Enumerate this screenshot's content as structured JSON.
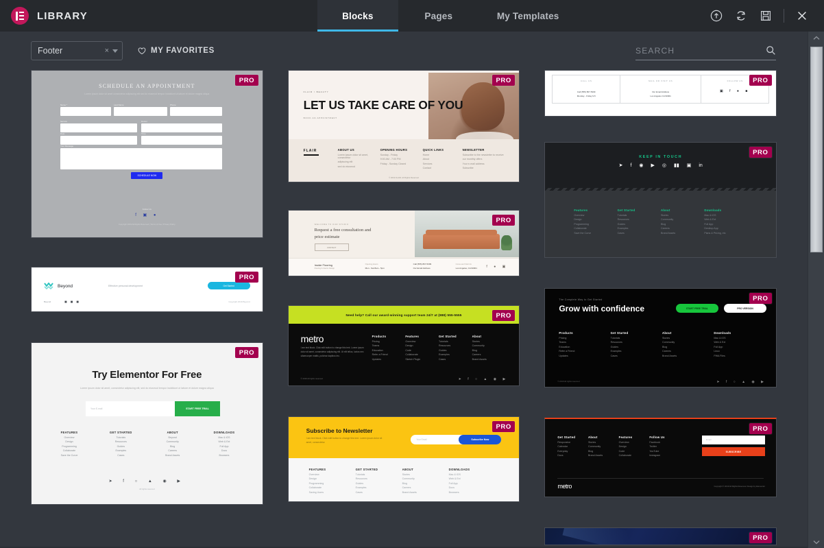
{
  "header": {
    "brand_title": "LIBRARY",
    "logo_icon": "elementor-logo-icon",
    "accent_color": "#c2185b",
    "tabs": [
      {
        "label": "Blocks",
        "active": true
      },
      {
        "label": "Pages",
        "active": false
      },
      {
        "label": "My Templates",
        "active": false
      }
    ],
    "active_tab_underline_color": "#3fb8e8",
    "actions": [
      {
        "name": "import-template-icon",
        "glyph": "↑"
      },
      {
        "name": "sync-library-icon",
        "glyph": "⟳"
      },
      {
        "name": "save-icon",
        "glyph": "Ὃe"
      },
      {
        "name": "close-icon",
        "glyph": "✕"
      }
    ]
  },
  "toolbar": {
    "filter": {
      "value": "Footer",
      "clear_label": "×",
      "caret": "chevron-down-icon"
    },
    "favorites_label": "MY FAVORITES",
    "favorites_icon": "heart-icon",
    "search": {
      "value": "",
      "placeholder": "SEARCH",
      "icon": "search-icon"
    }
  },
  "pro_badge_label": "PRO",
  "cards": {
    "appointment": {
      "title": "SCHEDULE AN APPOINTMENT",
      "subtitle": "Lorem ipsum dolor sit amet consectetur adipiscing elit sed do eiusmod tempor incididunt ut labore et dolore magna aliqua",
      "field_labels": [
        "Name *",
        "Last Name",
        "Phone"
      ],
      "selects": [
        "Service",
        "Doctor",
        "Date",
        "Time"
      ],
      "message_label": "Your Message",
      "message_value": "Add a message",
      "button_label": "SCHEDULE NOW",
      "follow_label": "Follow Us",
      "copyright": "Copyright 2019 All Rights Reserved | Terms of Use | Privacy Policy"
    },
    "beyond": {
      "brand": "Beyond",
      "tagline": "Effective personal development",
      "button_label": "Get Started",
      "left_label": "Beyond",
      "right_label": "Copyright 2019 Beyond",
      "accent_color": "#1ab6e0"
    },
    "try_elementor": {
      "title": "Try Elementor For Free",
      "subtitle": "Lorem ipsum dolor sit amet, consectetur adipiscing elit, sed do eiusmod tempor incididunt ut labore et dolore magna aliqua",
      "email_placeholder": "Your E-mail",
      "button_label": "START FREE TRIAL",
      "columns": [
        {
          "head": "FEATURES",
          "items": [
            "Overview",
            "Design",
            "Programming",
            "Collaborate",
            "Save the Curve"
          ]
        },
        {
          "head": "GET STARTED",
          "items": [
            "Tutorials",
            "Resources",
            "Guides",
            "Examples",
            "Cases"
          ]
        },
        {
          "head": "ABOUT",
          "items": [
            "Beyond",
            "Community",
            "Blog",
            "Careers",
            "Brand Assets"
          ]
        },
        {
          "head": "DOWNLOADS",
          "items": [
            "Mac & iOS",
            "Web & Ext",
            "Full App",
            "Docs",
            "Browsers"
          ]
        }
      ],
      "button_color": "#27ae4a",
      "copyright": "All rights reserved"
    },
    "flair": {
      "eyebrow": "FLAIR / BEAUTY",
      "title": "LET US TAKE CARE OF YOU",
      "cta": "BOOK AN APPOINTMENT",
      "brand": "FLAIR",
      "columns": [
        {
          "head": "ABOUT US",
          "items": [
            "Lorem ipsum dolor sit amet, consectetur",
            "adipiscing elit",
            "sed do eiusmod"
          ]
        },
        {
          "head": "OPENING HOURS",
          "items": [
            "Sunday - Friday",
            "9:00 AM - 7:00 PM",
            "Friday - Sunday Closed"
          ]
        },
        {
          "head": "QUICK LINKS",
          "items": [
            "Home",
            "About",
            "Services",
            "Contact"
          ]
        },
        {
          "head": "NEWSLETTER",
          "items": [
            "Subscribe to the newsletter to receive",
            "our monthly offers",
            "Your e-mail address",
            "Subscribe"
          ]
        }
      ],
      "copyright": "© 2019 FLAIR. All Rights Reserved"
    },
    "interior": {
      "eyebrow": "WELCOME TO OUR STUDIO",
      "title": "Request a free consultation and price estimate",
      "button_label": "CONTACT",
      "brand": "Inside Flooring",
      "brand_sub": "Flooring & Interior Design",
      "columns": [
        {
          "head": "Opening Hours",
          "items": [
            "Mon - Sat 8am - 5pm"
          ]
        },
        {
          "head": "Contact Us",
          "items": [
            "Call (555) 867-5309",
            "Our Email Address"
          ]
        },
        {
          "head": "Come and Visit Us",
          "items": [
            "Los Angeles, CA 90001"
          ]
        }
      ],
      "socials": [
        "facebook",
        "twitter",
        "instagram",
        "youtube"
      ]
    },
    "metro_lime": {
      "banner": "Need help? Call our award-winning support team 24/7 at (888) 555-5555",
      "brand": "metro",
      "body": "I am text block. Click edit button to change this text. Lorem ipsum dolor sit amet, consectetur adipiscing elit. Ut elit tellus, luctus nec ullamcorper mattis, pulvinar dapibus leo.",
      "columns": [
        {
          "head": "Products",
          "items": [
            "Pricing",
            "Teams",
            "Education",
            "Refer a Friend",
            "Updates"
          ]
        },
        {
          "head": "Features",
          "items": [
            "Overview",
            "Design",
            "Code",
            "Collaborate",
            "Sketch Plugin"
          ]
        },
        {
          "head": "Get Started",
          "items": [
            "Tutorials",
            "Resources",
            "Guides",
            "Examples",
            "Cases"
          ]
        },
        {
          "head": "About",
          "items": [
            "Stories",
            "Community",
            "Blog",
            "Careers",
            "Brand Assets"
          ]
        }
      ],
      "copyright": "© 2019 All rights reserved",
      "banner_color": "#c6e022"
    },
    "newsletter": {
      "title": "Subscribe to Newsletter",
      "subtitle": "I am text block. Click edit button to change this text. Lorem ipsum dolor sit amet, consectetur.",
      "email_placeholder": "Your Email",
      "button_label": "Subscribe Now",
      "columns": [
        {
          "head": "FEATURES",
          "items": [
            "Overview",
            "Design",
            "Programming",
            "Collaborate",
            "Saving Users"
          ]
        },
        {
          "head": "GET STARTED",
          "items": [
            "Tutorials",
            "Resources",
            "Guides",
            "Examples",
            "Cases"
          ]
        },
        {
          "head": "ABOUT",
          "items": [
            "Stories",
            "Community",
            "Blog",
            "Careers",
            "Brand Assets"
          ]
        },
        {
          "head": "DOWNLOADS",
          "items": [
            "Mac & iOS",
            "Web & Ext",
            "Full App",
            "Docs",
            "Browsers"
          ]
        }
      ],
      "banner_color": "#fbc412",
      "button_color": "#1a56d6"
    },
    "white_table": {
      "columns": [
        {
          "head": "CALL US",
          "items": [
            "Call (555) 867-5309",
            "Monday - Friday 9-5"
          ]
        },
        {
          "head": "MAIL OR VISIT US",
          "items": [
            "Our Email Address",
            "Los Angeles CA 90001"
          ]
        },
        {
          "head": "FOLLOW US",
          "items": []
        }
      ],
      "socials": [
        "instagram",
        "facebook",
        "twitter",
        "youtube"
      ]
    },
    "keep_in_touch": {
      "title": "KEEP IN TOUCH",
      "accent_color": "#15c98c",
      "socials": [
        "twitter",
        "facebook",
        "instagram",
        "youtube",
        "pinterest",
        "behance",
        "dribbble",
        "linkedin"
      ],
      "columns": [
        {
          "head": "Features",
          "items": [
            "Overview",
            "Design",
            "Programming",
            "Collaborate",
            "Save the Curve"
          ]
        },
        {
          "head": "Get Started",
          "items": [
            "Tutorials",
            "Resources",
            "Guides",
            "Examples",
            "Cases"
          ]
        },
        {
          "head": "About",
          "items": [
            "Stories",
            "Community",
            "Blog",
            "Careers",
            "Brand Assets"
          ]
        },
        {
          "head": "Downloads",
          "items": [
            "Mac & iOS",
            "Web & Ext",
            "Full App",
            "Desktop App",
            "Plans & Pricing, etc"
          ]
        }
      ]
    },
    "grow": {
      "eyebrow": "The Complete Way to Get Started",
      "title": "Grow with confidence",
      "primary_button": "START FREE TRIAL",
      "secondary_button": "PRO VERSION",
      "columns": [
        {
          "head": "Products",
          "items": [
            "Pricing",
            "Teams",
            "Education",
            "Refer a Friend",
            "Updates"
          ]
        },
        {
          "head": "Get Started",
          "items": [
            "Tutorials",
            "Resources",
            "Guides",
            "Examples",
            "Cases"
          ]
        },
        {
          "head": "About",
          "items": [
            "Stories",
            "Community",
            "Blog",
            "Careers",
            "Brand Assets"
          ]
        },
        {
          "head": "Downloads",
          "items": [
            "Mac & iOS",
            "Web & Ext",
            "Full App",
            "Linux",
            "PWA Files"
          ]
        }
      ],
      "copyright": "© 2019 All rights reserved",
      "primary_color": "#17c63c"
    },
    "metro_red": {
      "columns": [
        {
          "head": "Get Started",
          "items": [
            "Responsive",
            "Calendar",
            "Everyday",
            "Docs"
          ]
        },
        {
          "head": "About",
          "items": [
            "Stories",
            "Community",
            "Blog",
            "Brand Assets"
          ]
        },
        {
          "head": "Features",
          "items": [
            "Overview",
            "Design",
            "Code",
            "Collaborate"
          ]
        },
        {
          "head": "Follow Us",
          "items": [
            "Facebook",
            "Twitter",
            "YouTube",
            "Instagram"
          ]
        }
      ],
      "email_placeholder": "Email",
      "button_label": "SUBSCRIBE",
      "brand": "metro",
      "copyright": "Copyright © 2019 All Rights Reserved. Design by Elementor",
      "accent_color": "#e8401a"
    }
  },
  "scrollbar": {
    "up_arrow": "chevron-up-icon",
    "down_arrow": "chevron-down-icon",
    "thumb_name": "scrollbar-thumb"
  }
}
